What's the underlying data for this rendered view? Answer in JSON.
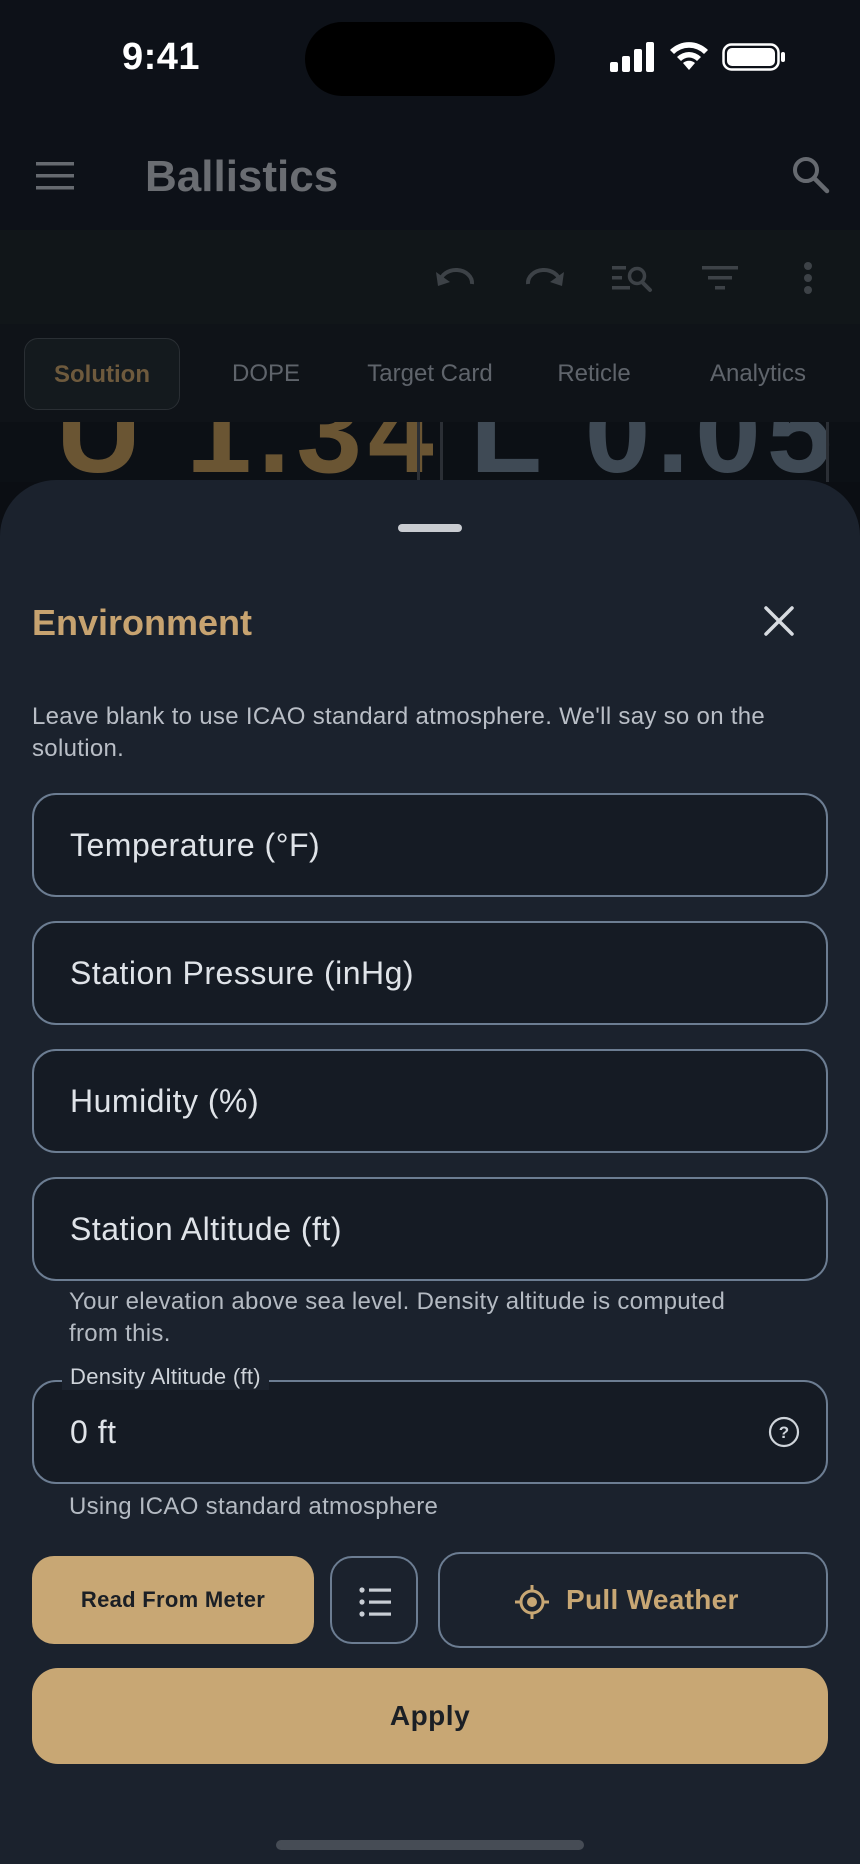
{
  "status": {
    "time": "9:41"
  },
  "app": {
    "title": "Ballistics"
  },
  "tabs": [
    {
      "label": "Solution",
      "active": true
    },
    {
      "label": "DOPE"
    },
    {
      "label": "Target Card"
    },
    {
      "label": "Reticle"
    },
    {
      "label": "Analytics"
    }
  ],
  "peek": {
    "left_value": "U 1.34",
    "right_value": "L 0.05"
  },
  "sheet": {
    "title": "Environment",
    "description": "Leave blank to use ICAO standard atmosphere. We'll say so on the solution.",
    "fields": {
      "temperature": "Temperature (°F)",
      "pressure": "Station Pressure (inHg)",
      "humidity": "Humidity (%)",
      "altitude": "Station Altitude (ft)"
    },
    "altitude_helper": "Your elevation above sea level. Density altitude is computed from this.",
    "density": {
      "label": "Density Altitude (ft)",
      "value": "0 ft",
      "helper": "Using ICAO standard atmosphere"
    },
    "buttons": {
      "meter": "Read From Meter",
      "weather": "Pull Weather",
      "apply": "Apply"
    }
  },
  "colors": {
    "accent": "#c8a774",
    "sheet_bg": "#1b222d",
    "outline": "#6c7d92"
  }
}
